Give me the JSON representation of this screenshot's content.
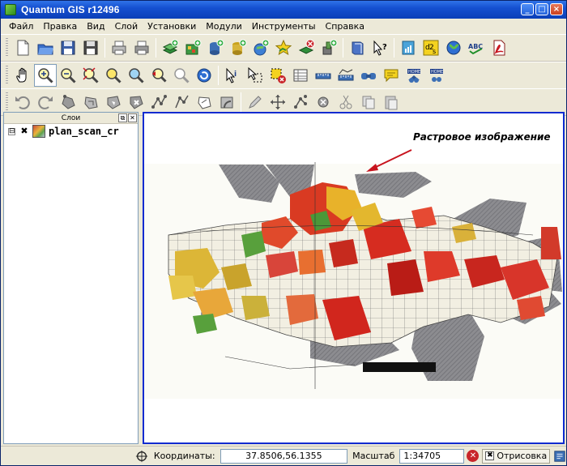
{
  "window": {
    "title": "Quantum GIS r12496"
  },
  "menu": [
    "Файл",
    "Правка",
    "Вид",
    "Слой",
    "Установки",
    "Модули",
    "Инструменты",
    "Справка"
  ],
  "toolbars": {
    "row1": [
      "new-project-icon",
      "open-project-icon",
      "save-project-icon",
      "save-as-icon",
      "print-icon",
      "print-composer-icon",
      "add-vector-layer-icon",
      "add-raster-layer-icon",
      "add-postgis-layer-icon",
      "add-spatialite-layer-icon",
      "add-wms-layer-icon",
      "new-vector-layer-icon",
      "remove-layer-icon",
      "add-wfs-layer-icon",
      "help-book-icon",
      "whats-this-icon",
      "plugin-installer-icon",
      "d2s-icon",
      "globe-icon",
      "spell-abc-icon",
      "pdf-icon"
    ],
    "row2": [
      "pan-hand-icon",
      "zoom-in-icon",
      "zoom-out-icon",
      "zoom-full-icon",
      "zoom-selection-icon",
      "zoom-layer-icon",
      "zoom-last-icon",
      "zoom-next-icon",
      "refresh-icon",
      "identify-icon",
      "select-icon",
      "deselect-icon",
      "attribute-table-icon",
      "measure-line-icon",
      "measure-area-icon",
      "new-bookmark-icon",
      "map-tips-icon",
      "show-bookmarks-icon",
      "home-icon"
    ],
    "row3": [
      "undo-icon",
      "redo-icon",
      "capture-point-icon",
      "capture-line-icon",
      "capture-polygon-icon",
      "move-feature-icon",
      "node-tool-icon",
      "delete-selected-icon",
      "cut-feature-icon",
      "add-ring-icon",
      "add-island-icon",
      "split-feature-icon",
      "edit-pen-icon",
      "move-vertex-icon",
      "merge-icon",
      "delete-part-icon",
      "cut-icon",
      "copy-icon",
      "paste-icon"
    ]
  },
  "panel": {
    "title": "Слои",
    "float_glyph": "⧉",
    "close_glyph": "✕"
  },
  "layers": [
    {
      "name": "plan_scan_cr",
      "expander": "⊟",
      "checked_glyph": "✖"
    }
  ],
  "map": {
    "annotation": "Растровое изображение",
    "arrow_color": "#c8141e"
  },
  "status": {
    "coords_label": "Координаты:",
    "coords_value": "37.8506,56.1355",
    "scale_label": "Масштаб",
    "scale_value": "1:34705",
    "render_label": "Отрисовка",
    "stop_glyph": "✕",
    "render_glyph": "✖"
  },
  "colors": {
    "title_bar": "#1550d0",
    "map_border": "#0f2bd0",
    "annotation_arrow": "#c8141e"
  }
}
